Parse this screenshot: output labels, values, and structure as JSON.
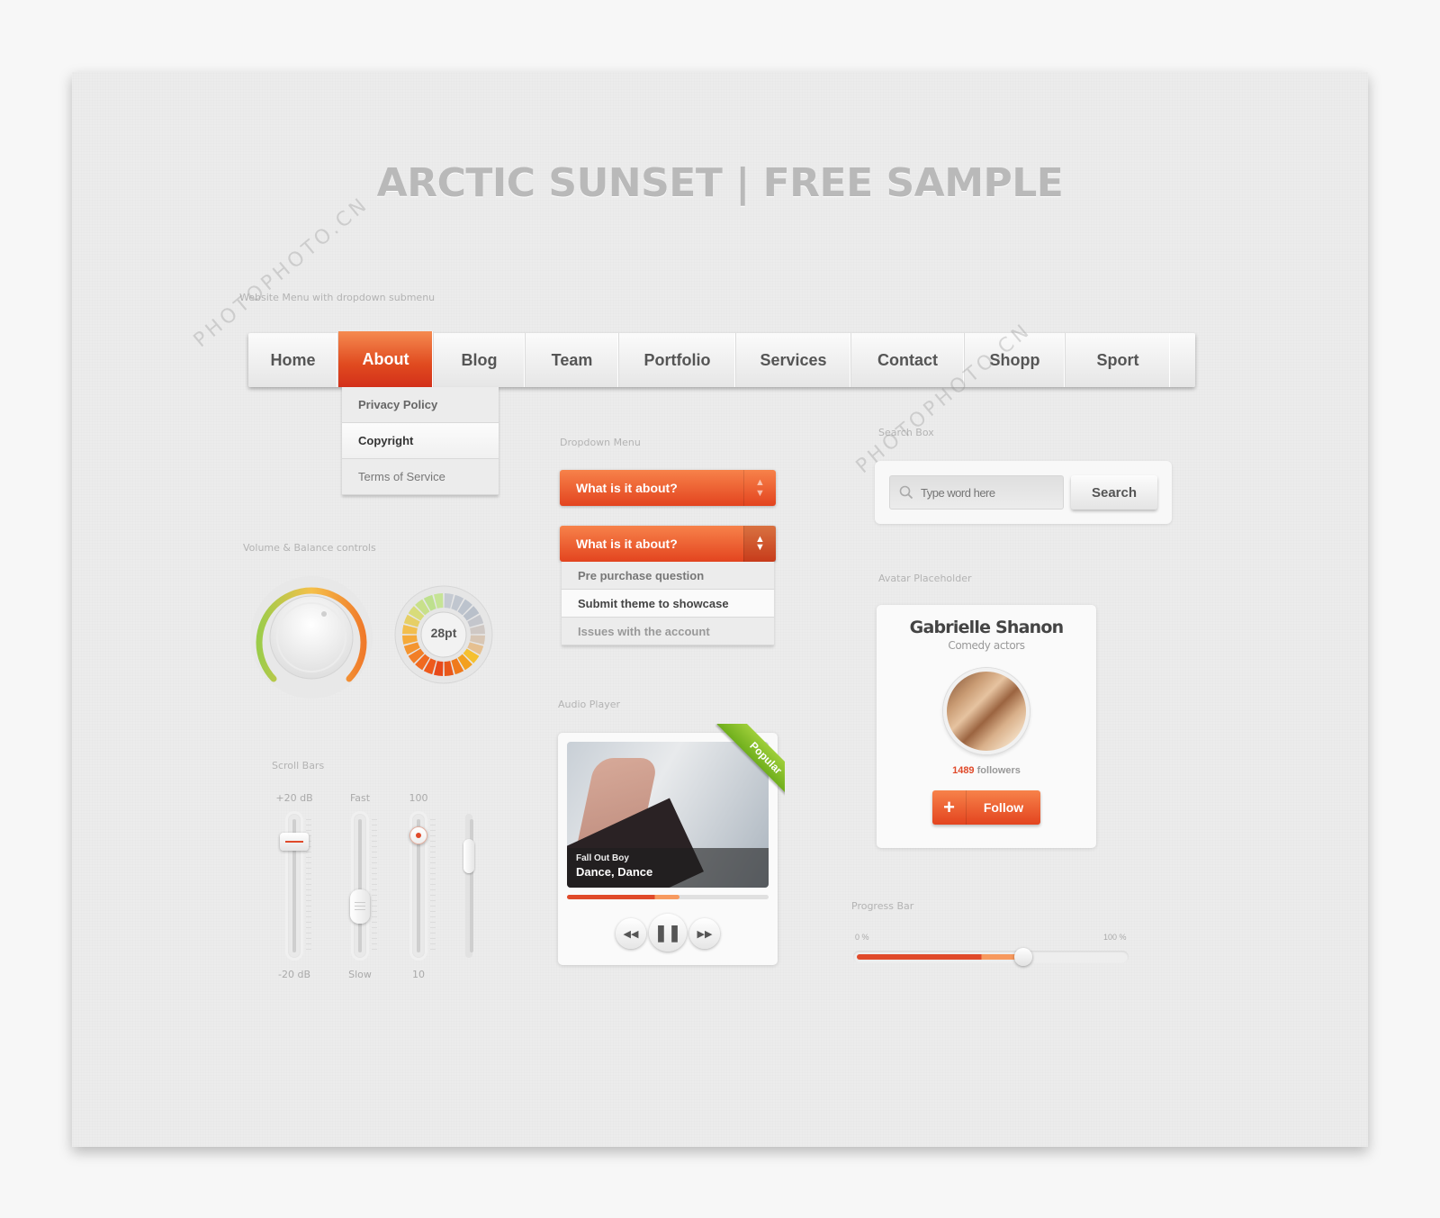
{
  "page": {
    "title": "ARCTIC SUNSET | FREE SAMPLE",
    "watermark": "PHOTOPHOTO.CN"
  },
  "nav": {
    "section_label": "Website Menu with dropdown submenu",
    "items": [
      {
        "label": "Home",
        "active": false
      },
      {
        "label": "About",
        "active": true
      },
      {
        "label": "Blog",
        "active": false
      },
      {
        "label": "Team",
        "active": false
      },
      {
        "label": "Portfolio",
        "active": false
      },
      {
        "label": "Services",
        "active": false
      },
      {
        "label": "Contact",
        "active": false
      },
      {
        "label": "Shopp",
        "active": false
      },
      {
        "label": "Sport",
        "active": false
      }
    ],
    "submenu": [
      {
        "label": "Privacy Policy"
      },
      {
        "label": "Copyright"
      },
      {
        "label": "Terms of Service"
      }
    ]
  },
  "dropdown": {
    "section_label": "Dropdown Menu",
    "closed_label": "What is it about?",
    "open_label": "What is it about?",
    "options": [
      {
        "label": "Pre purchase question"
      },
      {
        "label": "Submit theme to showcase"
      },
      {
        "label": "Issues with the account"
      }
    ]
  },
  "search": {
    "section_label": "Search Box",
    "placeholder": "Type word here",
    "value": "",
    "button_label": "Search"
  },
  "controls": {
    "section_label": "Volume & Balance controls",
    "dial_value": "28pt"
  },
  "sliders": {
    "section_label": "Scroll Bars",
    "items": [
      {
        "top_label": "+20 dB",
        "bottom_label": "-20 dB",
        "value": 0.85
      },
      {
        "top_label": "Fast",
        "bottom_label": "Slow",
        "value": 0.4
      },
      {
        "top_label": "100",
        "bottom_label": "10",
        "value": 0.9
      },
      {
        "top_label": "",
        "bottom_label": "",
        "value": 0.8
      }
    ]
  },
  "audio": {
    "section_label": "Audio Player",
    "badge": "Popular",
    "artist": "Fall Out Boy",
    "song": "Dance, Dance",
    "progress": 0.56
  },
  "profile": {
    "section_label": "Avatar Placeholder",
    "name": "Gabrielle Shanon",
    "role": "Comedy actors",
    "followers_count": "1489",
    "followers_label": "followers",
    "follow_label": "Follow"
  },
  "progress_bar": {
    "section_label": "Progress Bar",
    "min_label": "0 %",
    "max_label": "100 %",
    "value": 0.62
  },
  "colors": {
    "accent": "#e3441f",
    "accent_light": "#f7824a",
    "ribbon": "#7fbf25",
    "text_muted": "#b3b3b3"
  }
}
